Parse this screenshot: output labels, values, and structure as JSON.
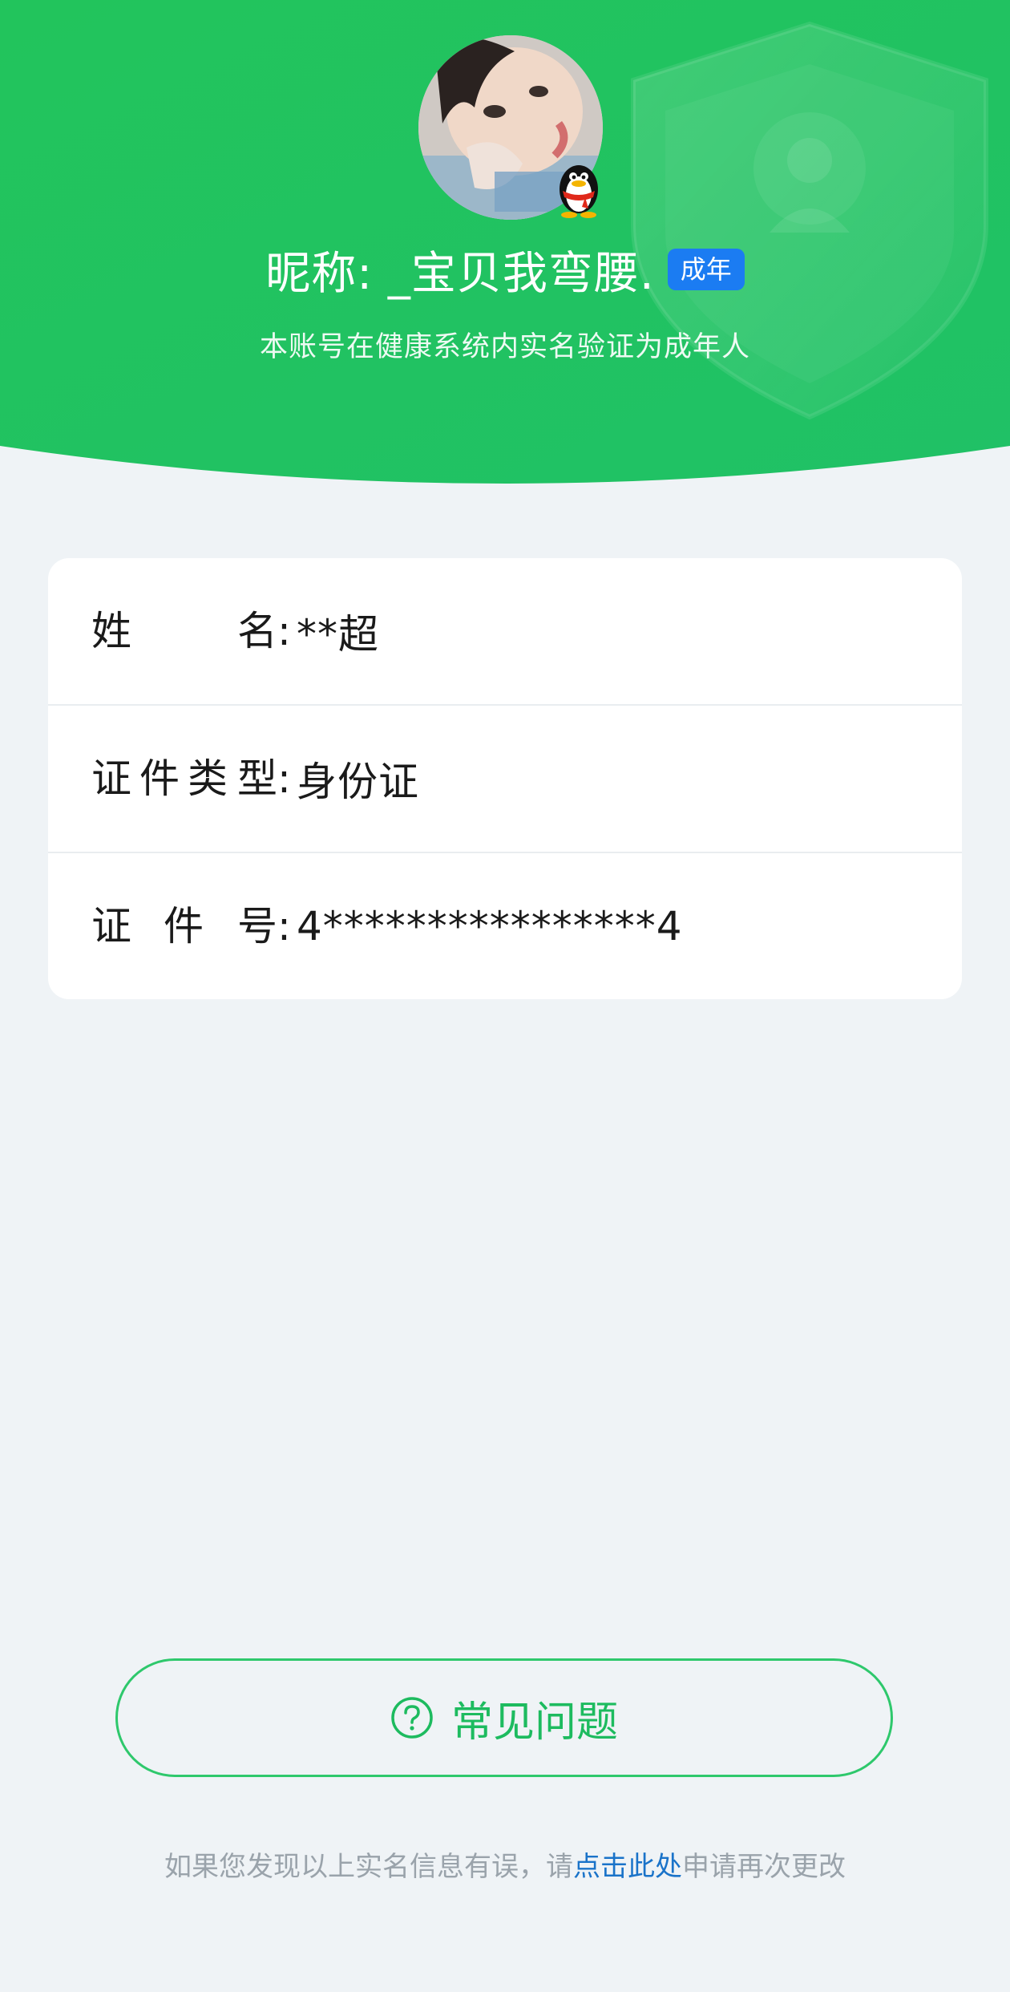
{
  "header": {
    "nickname": "昵称: _宝贝我弯腰.",
    "badge": "成年",
    "verify_text": "本账号在健康系统内实名验证为成年人",
    "gradient_start": "#26c561",
    "gradient_end": "#1fc266",
    "badge_color": "#1b7cf2"
  },
  "icons": {
    "avatar": "avatar-photo",
    "qq": "qq-penguin-icon",
    "shield": "shield-watermark-icon",
    "faq": "question-circle-icon"
  },
  "info": {
    "name": {
      "label_chars": [
        "姓",
        "名:"
      ],
      "value": "**超"
    },
    "id_type": {
      "label_chars": [
        "证",
        "件",
        "类",
        "型:"
      ],
      "value": "身份证"
    },
    "id_number": {
      "label_chars": [
        "证",
        "件",
        "号:"
      ],
      "value": "4****************4"
    }
  },
  "faq_button": {
    "label": "常见问题",
    "color": "#1dbb5f"
  },
  "footer": {
    "prefix": "如果您发现以上实名信息有误，请",
    "link": "点击此处",
    "suffix": "申请再次更改",
    "link_color": "#1a73c9"
  }
}
